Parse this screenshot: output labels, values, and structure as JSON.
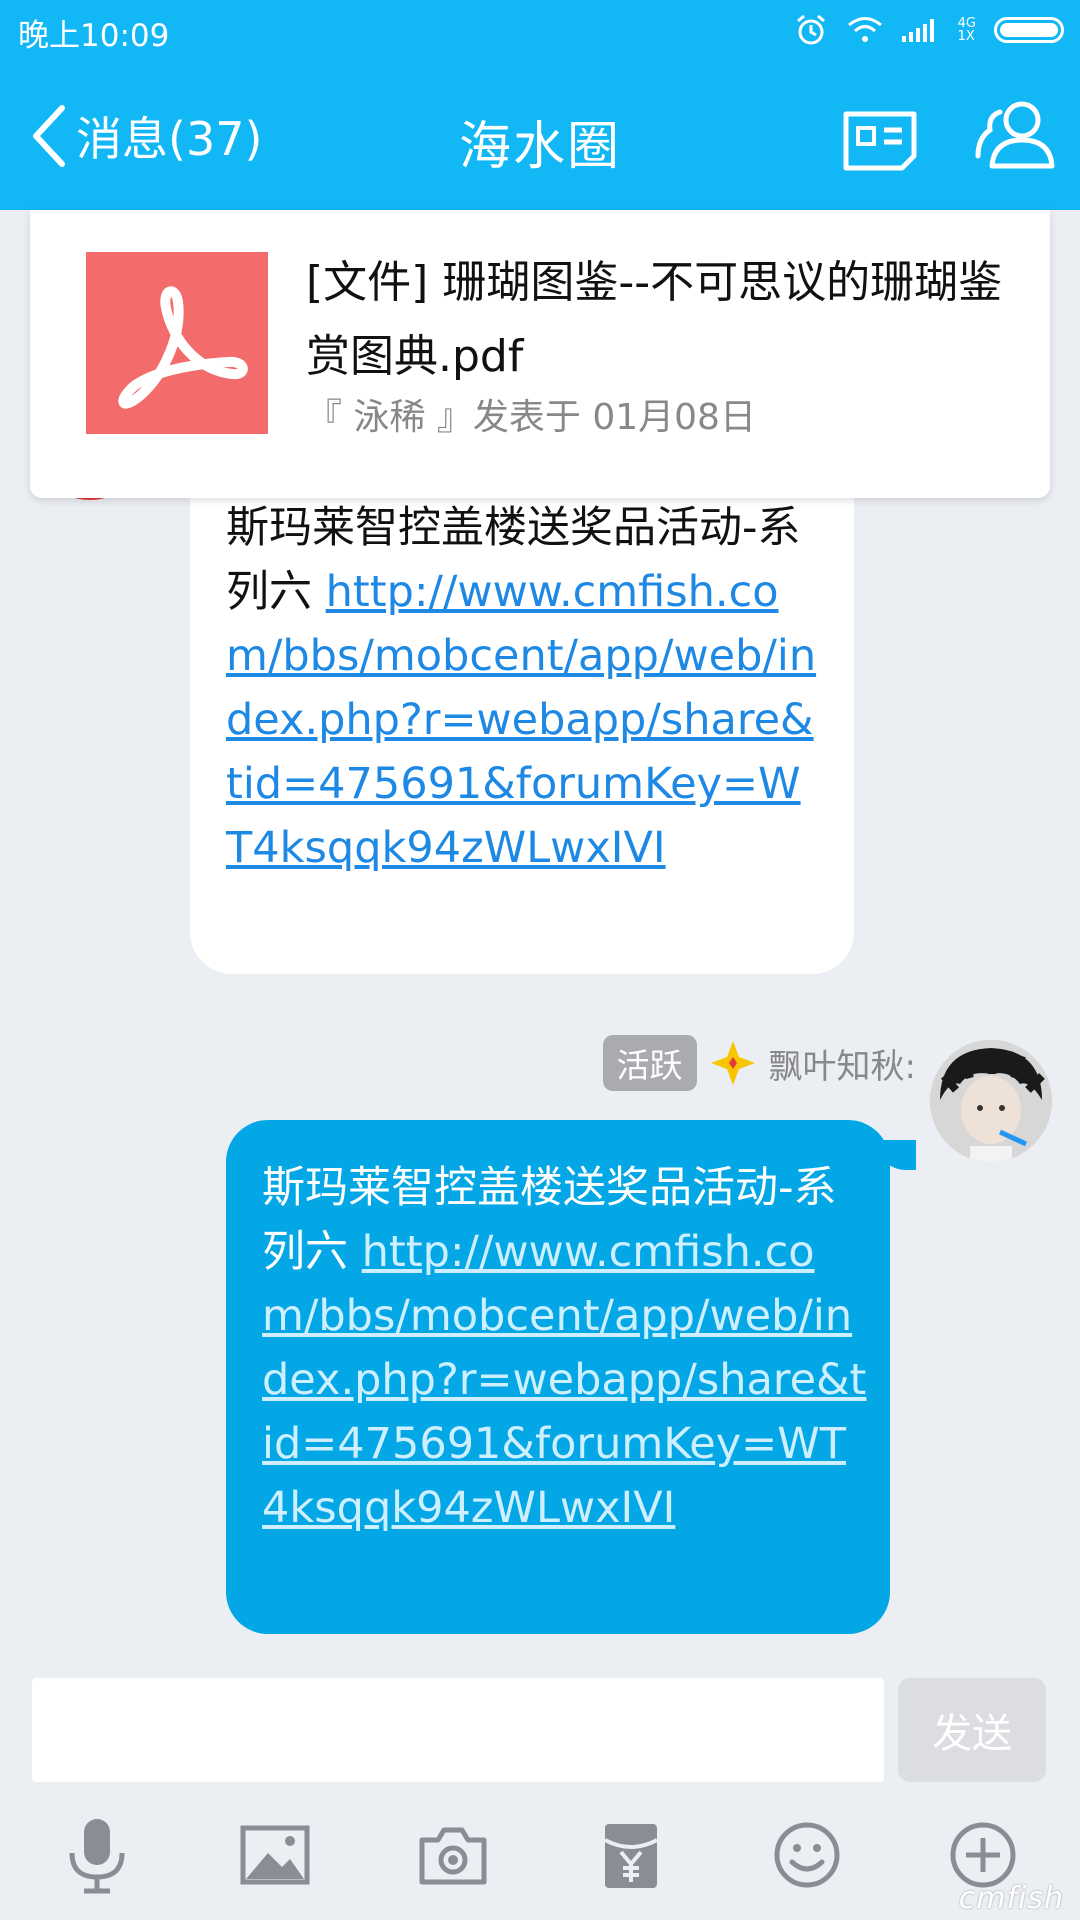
{
  "status_bar": {
    "time": "晚上10:09",
    "network_top": "4G",
    "network_bottom": "1X"
  },
  "header": {
    "back_label": "消息(37)",
    "title": "海水圈"
  },
  "pinned_file": {
    "title": "[文件] 珊瑚图鉴--不可思议的珊瑚鉴赏图典.pdf",
    "meta": "『 泳稀 』发表于 01月08日"
  },
  "messages": [
    {
      "text": "斯玛莱智控盖楼送奖品活动-系列六 ",
      "link": "http://www.cmfish.com/bbs/mobcent/app/web/index.php?r=webapp/share&tid=475691&forumKey=WT4ksqqk94zWLwxIVI"
    },
    {
      "badge": "活跃",
      "sender": "飘叶知秋:",
      "text": "斯玛莱智控盖楼送奖品活动-系列六 ",
      "link": "http://www.cmfish.com/bbs/mobcent/app/web/index.php?r=webapp/share&tid=475691&forumKey=WT4ksqqk94zWLwxIVI"
    }
  ],
  "composer": {
    "placeholder": "",
    "send_label": "发送"
  },
  "toolbar": {
    "icons": [
      "microphone-icon",
      "image-icon",
      "camera-icon",
      "red-packet-icon",
      "emoji-icon",
      "plus-icon"
    ]
  },
  "watermark": "cmfish",
  "colors": {
    "brand_blue": "#12B7F5",
    "outgoing_bubble": "#03A7E6",
    "pdf_red": "#F36B6B",
    "background": "#EBEEF3"
  }
}
